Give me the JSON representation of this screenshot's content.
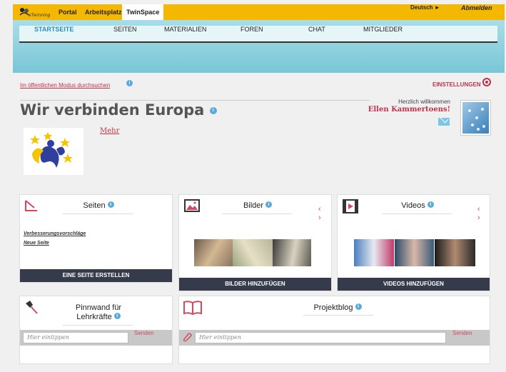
{
  "topbar": {
    "logo_text": "eTwinning",
    "nav": [
      "Portal",
      "Arbeitsplatz",
      "TwinSpace"
    ],
    "language": "Deutsch ►",
    "logout": "Abmelden"
  },
  "menu": {
    "items": [
      "STARTSEITE",
      "SEITEN",
      "MATERIALIEN",
      "FOREN",
      "CHAT",
      "MITGLIEDER"
    ]
  },
  "header": {
    "browse_public": "Im öffentlichen Modus durchsuchen",
    "settings": "EINSTELLUNGEN",
    "title": "Wir verbinden Europa",
    "welcome": "Herzlich willkommen",
    "user_name": "Ellen Kammertoens!",
    "more": "Mehr"
  },
  "widgets": {
    "pages": {
      "title": "Seiten",
      "links": [
        "Verbesserungsvorschläge",
        "Neue Seite"
      ],
      "action": "EINE SEITE ERSTELLEN"
    },
    "images": {
      "title": "Bilder",
      "nav": "‹ ›",
      "action": "BILDER HINZUFÜGEN"
    },
    "videos": {
      "title": "Videos",
      "nav": "‹ ›",
      "action": "VIDEOS HINZUFÜGEN"
    },
    "pinboard": {
      "title_line1": "Pinnwand für",
      "title_line2": "Lehrkräfte",
      "placeholder": "Hier eintippen",
      "send": "Senden"
    },
    "blog": {
      "title": "Projektblog",
      "placeholder": "Hier eintippen",
      "send": "Senden"
    }
  },
  "colors": {
    "topbar": "#f5b800",
    "accent": "#c0334a",
    "action_bar": "#353b4b",
    "menu_active": "#2a8fc0"
  }
}
